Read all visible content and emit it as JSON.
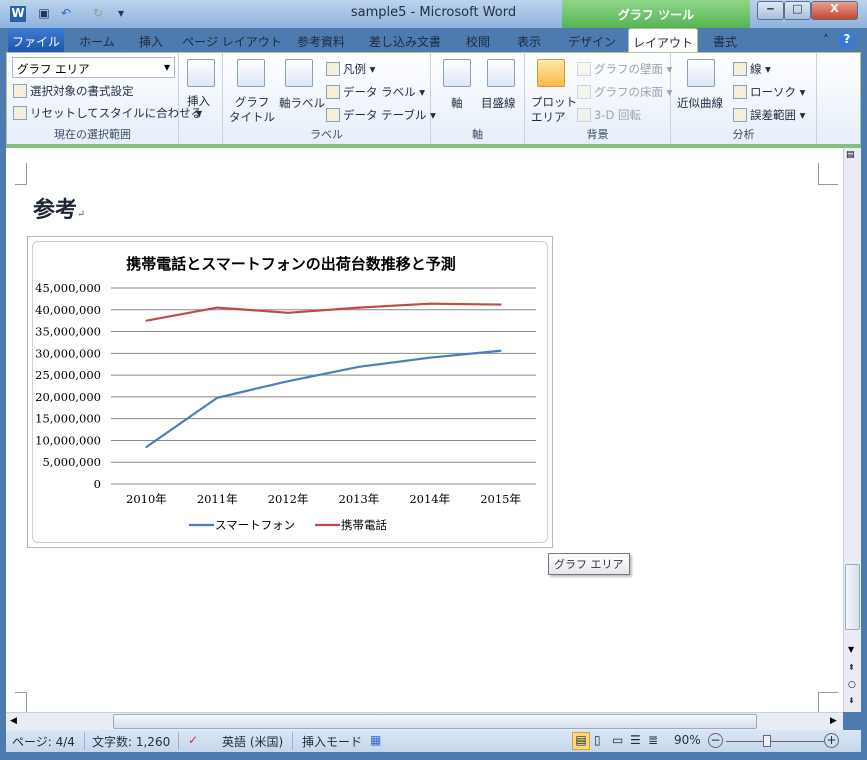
{
  "window": {
    "title": "sample5 - Microsoft Word",
    "tool_context": "グラフ ツール",
    "minimize": "‒",
    "maximize": "□",
    "close": "X"
  },
  "tabs": [
    {
      "label": "ファイル"
    },
    {
      "label": "ホーム"
    },
    {
      "label": "挿入"
    },
    {
      "label": "ページ レイアウト"
    },
    {
      "label": "参考資料"
    },
    {
      "label": "差し込み文書"
    },
    {
      "label": "校閲"
    },
    {
      "label": "表示"
    },
    {
      "label": "デザイン"
    },
    {
      "label": "レイアウト",
      "active": true
    },
    {
      "label": "書式"
    }
  ],
  "ribbon": {
    "selection": {
      "combo_value": "グラフ エリア",
      "format": "選択対象の書式設定",
      "reset": "リセットしてスタイルに合わせる",
      "label": "現在の選択範囲"
    },
    "insert": {
      "label": "挿入"
    },
    "labels": {
      "chart_title": "グラフ\nタイトル",
      "axis_title": "軸ラベル",
      "legend": "凡例",
      "data_labels": "データ ラベル",
      "data_table": "データ テーブル",
      "label": "ラベル"
    },
    "axes": {
      "axes": "軸",
      "gridlines": "目盛線",
      "label": "軸"
    },
    "background": {
      "plot_area": "プロット\nエリア",
      "wall": "グラフの壁面",
      "floor": "グラフの床面",
      "rotation": "3-D 回転",
      "label": "背景"
    },
    "analysis": {
      "trendline": "近似曲線",
      "lines": "線",
      "updown": "ローソク",
      "error_bars": "誤差範囲",
      "label": "分析"
    }
  },
  "document": {
    "heading": "参考",
    "tooltip": "グラフ エリア"
  },
  "status": {
    "page": "ページ: 4/4",
    "words": "文字数: 1,260",
    "language": "英語 (米国)",
    "mode": "挿入モード",
    "zoom": "90%"
  },
  "colors": {
    "smartphone": "#4a7ebb",
    "mobile": "#be4b48",
    "accent": "#56b454"
  },
  "chart_data": {
    "type": "line",
    "title": "携帯電話とスマートフォンの出荷台数推移と予測",
    "categories": [
      "2010年",
      "2011年",
      "2012年",
      "2013年",
      "2014年",
      "2015年"
    ],
    "series": [
      {
        "name": "スマートフォン",
        "values": [
          8500000,
          19800000,
          23600000,
          26900000,
          29000000,
          30600000
        ]
      },
      {
        "name": "携帯電話",
        "values": [
          37500000,
          40500000,
          39300000,
          40500000,
          41400000,
          41200000
        ]
      }
    ],
    "ylim": [
      0,
      45000000
    ],
    "yticks": [
      "0",
      "5,000,000",
      "10,000,000",
      "15,000,000",
      "20,000,000",
      "25,000,000",
      "30,000,000",
      "35,000,000",
      "40,000,000",
      "45,000,000"
    ],
    "grid": true,
    "legend": "bottom"
  }
}
